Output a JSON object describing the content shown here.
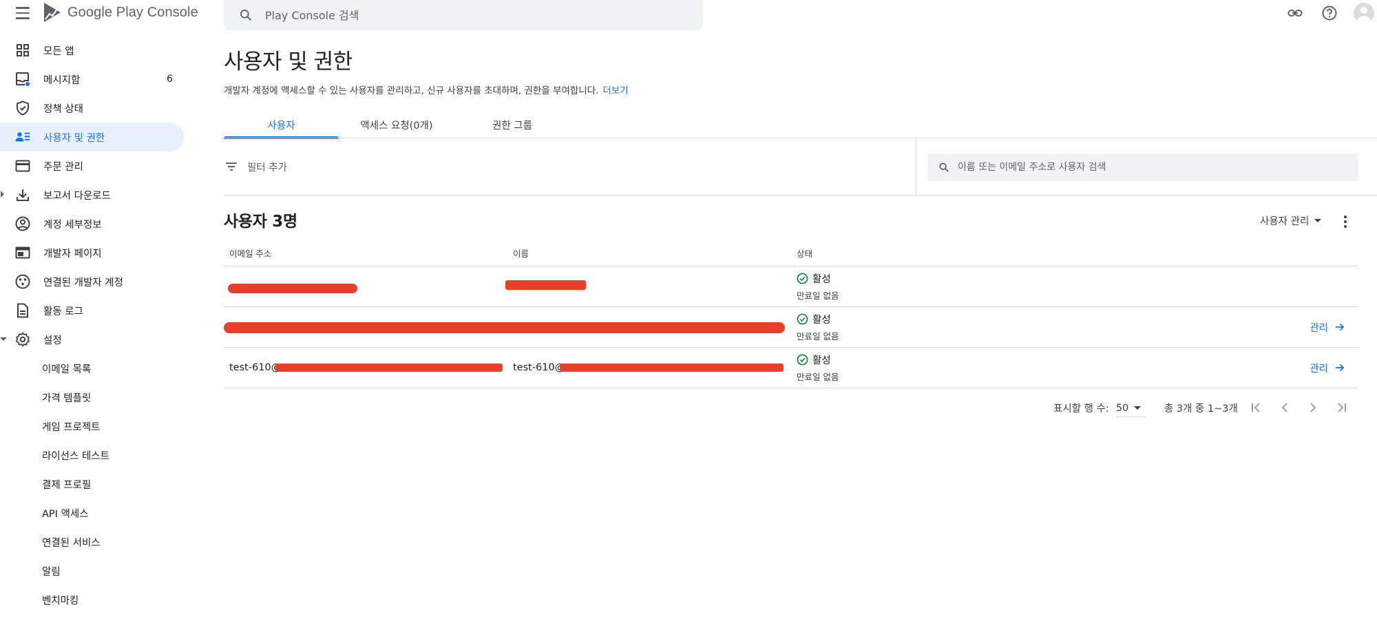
{
  "header": {
    "logo_text": "Google Play Console",
    "search_placeholder": "Play Console 검색"
  },
  "sidebar": {
    "items": [
      {
        "label": "모든 앱",
        "icon": "grid-icon"
      },
      {
        "label": "메시지함",
        "icon": "inbox-icon",
        "badge": "6"
      },
      {
        "label": "정책 상태",
        "icon": "shield-icon"
      },
      {
        "label": "사용자 및 권한",
        "icon": "manage-accounts-icon",
        "active": true
      },
      {
        "label": "주문 관리",
        "icon": "credit-card-icon"
      },
      {
        "label": "보고서 다운로드",
        "icon": "download-icon"
      },
      {
        "label": "계정 세부정보",
        "icon": "account-circle-icon"
      },
      {
        "label": "개발자 페이지",
        "icon": "web-icon"
      },
      {
        "label": "연결된 개발자 계정",
        "icon": "linked-accounts-icon"
      },
      {
        "label": "활동 로그",
        "icon": "document-icon"
      },
      {
        "label": "설정",
        "icon": "gear-icon"
      }
    ],
    "settings_subitems": [
      "이메일 목록",
      "가격 템플릿",
      "게임 프로젝트",
      "라이선스 테스트",
      "결제 프로필",
      "API 액세스",
      "연결된 서비스",
      "알림",
      "벤치마킹"
    ]
  },
  "main": {
    "title": "사용자 및 권한",
    "description": "개발자 계정에 액세스할 수 있는 사용자를 관리하고, 신규 사용자를 초대하며, 권한을 부여합니다.",
    "learn_more": "더보기",
    "tabs": [
      {
        "label": "사용자",
        "active": true
      },
      {
        "label": "액세스 요청(0개)"
      },
      {
        "label": "권한 그룹"
      }
    ],
    "filter_label": "필터 추가",
    "user_search_placeholder": "이름 또는 이메일 주소로 사용자 검색",
    "section_title": "사용자 3명",
    "manage_users_label": "사용자 관리",
    "table": {
      "headers": {
        "email": "이메일 주소",
        "name": "이름",
        "status": "상태"
      },
      "rows": [
        {
          "email": "",
          "name": "",
          "status": "활성",
          "expiry": "만료일 없음",
          "action": ""
        },
        {
          "email": "",
          "name": "",
          "status": "활성",
          "expiry": "만료일 없음",
          "action": "관리"
        },
        {
          "email": "test-610@",
          "name": "test-610@",
          "status": "활성",
          "expiry": "만료일 없음",
          "action": "관리"
        }
      ]
    },
    "pagination": {
      "rows_per_page_label": "표시할 행 수:",
      "rows_per_page": "50",
      "range": "총 3개 중 1~3개"
    }
  },
  "colors": {
    "accent": "#1a73e8",
    "active_nav_bg": "#e8f0fe",
    "status_green": "#188038",
    "redaction": "#e8402c"
  }
}
